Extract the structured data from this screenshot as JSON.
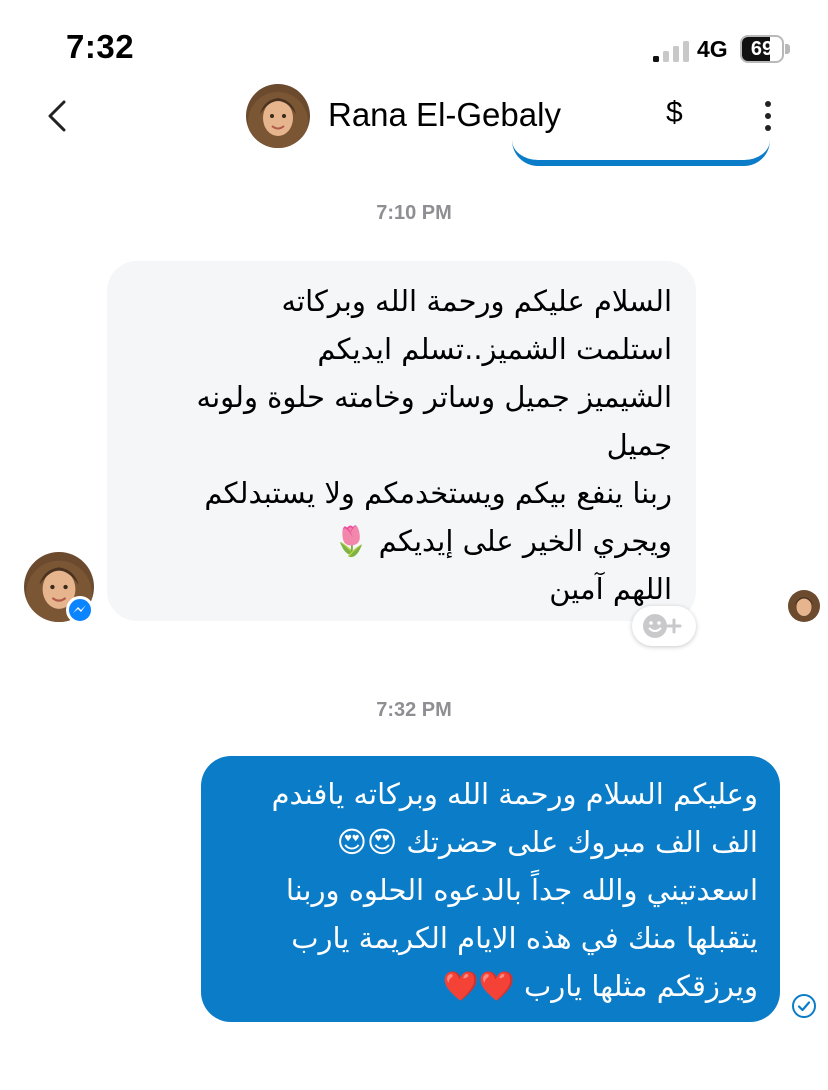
{
  "status_bar": {
    "time": "7:32",
    "network": "4G",
    "battery_level": "69",
    "battery_fraction": 0.69
  },
  "header": {
    "contact_name": "Rana El-Gebaly",
    "payment_icon": "$",
    "back_icon": "chevron-left-icon",
    "more_icon": "vertical-dots-icon"
  },
  "messages": {
    "timestamp_1": "7:10 PM",
    "incoming": {
      "lines": [
        "السلام عليكم ورحمة الله وبركاته",
        "استلمت الشميز..تسلم ايديكم",
        "الشيميز جميل وساتر وخامته حلوة ولونه",
        "جميل",
        "ربنا ينفع بيكم ويستخدمكم ولا يستبدلكم",
        "ويجري الخير على إيديكم 🌷",
        "اللهم آمين"
      ]
    },
    "timestamp_2": "7:32 PM",
    "outgoing": {
      "lines": [
        "وعليكم السلام ورحمة الله وبركاته يافندم",
        "الف الف مبروك على حضرتك 😍😍",
        "اسعدتيني والله جداً بالدعوه الحلوه وربنا",
        "يتقبلها منك في هذه الايام الكريمة يارب",
        "ويرزقكم مثلها يارب ❤️❤️"
      ]
    }
  },
  "colors": {
    "outgoing_bubble": "#0a7cc8",
    "incoming_bubble": "#f5f6f8",
    "timestamp": "#8e8e93",
    "messenger_badge": "#0b84ff"
  }
}
